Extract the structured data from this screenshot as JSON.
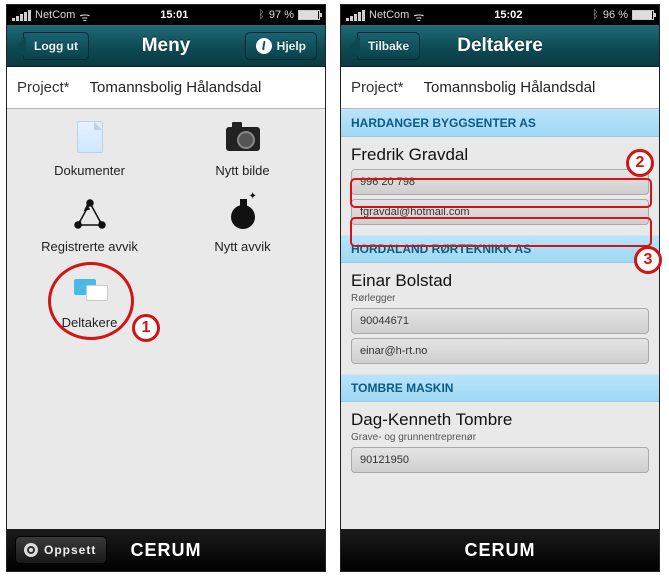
{
  "left": {
    "status": {
      "carrier": "NetCom",
      "time": "15:01",
      "battery": "97 %"
    },
    "nav": {
      "title": "Meny",
      "logout": "Logg ut",
      "help": "Hjelp"
    },
    "project": {
      "label": "Project*",
      "value": "Tomannsbolig Hålandsdal"
    },
    "tiles": {
      "documents": "Dokumenter",
      "newphoto": "Nytt bilde",
      "regavvik": "Registrerte avvik",
      "newavvik": "Nytt avvik",
      "participants": "Deltakere"
    },
    "footer": {
      "setup": "Oppsett",
      "brand": "CERUM"
    }
  },
  "right": {
    "status": {
      "carrier": "NetCom",
      "time": "15:02",
      "battery": "96 %"
    },
    "nav": {
      "title": "Deltakere",
      "back": "Tilbake"
    },
    "project": {
      "label": "Project*",
      "value": "Tomannsbolig Hålandsdal"
    },
    "sections": [
      {
        "header": "HARDANGER BYGGSENTER AS",
        "contacts": [
          {
            "name": "Fredrik Gravdal",
            "role": "",
            "phone": "996 20 798",
            "email": "fgravdal@hotmail.com"
          }
        ]
      },
      {
        "header": "HORDALAND RØRTEKNIKK AS",
        "contacts": [
          {
            "name": "Einar Bolstad",
            "role": "Rørlegger",
            "phone": "90044671",
            "email": "einar@h-rt.no"
          }
        ]
      },
      {
        "header": "TOMBRE MASKIN",
        "contacts": [
          {
            "name": "Dag-Kenneth Tombre",
            "role": "Grave- og grunnentreprenør",
            "phone": "90121950",
            "email": ""
          }
        ]
      }
    ],
    "footer": {
      "brand": "CERUM"
    }
  },
  "callouts": {
    "one": "1",
    "two": "2",
    "three": "3"
  }
}
